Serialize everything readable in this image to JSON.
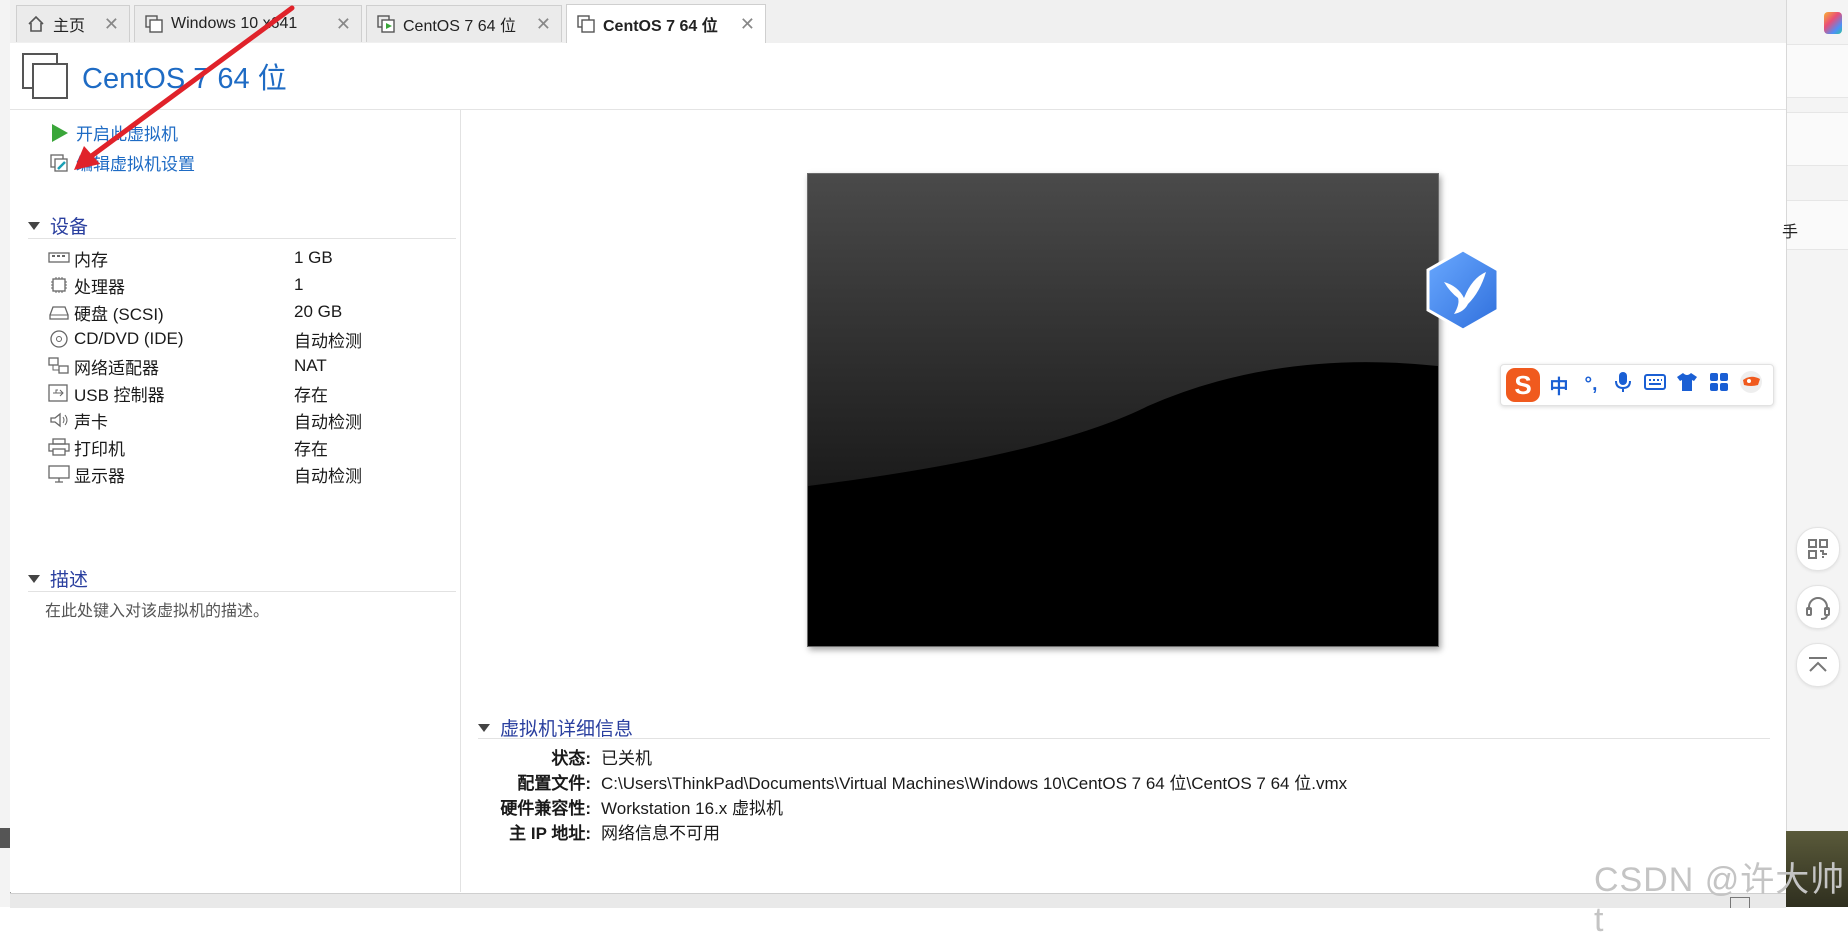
{
  "tabs": [
    {
      "label": "主页",
      "icon": "home-icon"
    },
    {
      "label": "Windows 10 x641",
      "icon": "vm-icon"
    },
    {
      "label": "CentOS 7 64 位",
      "icon": "vm-play-icon"
    },
    {
      "label": "CentOS 7 64 位",
      "icon": "vm-icon",
      "active": true
    }
  ],
  "header": {
    "title": "CentOS 7 64 位"
  },
  "commands": {
    "power_on": "开启此虚拟机",
    "edit_settings": "编辑虚拟机设置"
  },
  "devices": {
    "heading": "设备",
    "items": [
      {
        "name": "内存",
        "value": "1 GB",
        "icon": "memory-icon"
      },
      {
        "name": "处理器",
        "value": "1",
        "icon": "cpu-icon"
      },
      {
        "name": "硬盘 (SCSI)",
        "value": "20 GB",
        "icon": "hard-disk-icon"
      },
      {
        "name": "CD/DVD (IDE)",
        "value": "自动检测",
        "icon": "cd-dvd-icon"
      },
      {
        "name": "网络适配器",
        "value": "NAT",
        "icon": "network-adapter-icon"
      },
      {
        "name": "USB 控制器",
        "value": "存在",
        "icon": "usb-icon"
      },
      {
        "name": "声卡",
        "value": "自动检测",
        "icon": "speaker-icon"
      },
      {
        "name": "打印机",
        "value": "存在",
        "icon": "printer-icon"
      },
      {
        "name": "显示器",
        "value": "自动检测",
        "icon": "monitor-icon"
      }
    ]
  },
  "description": {
    "heading": "描述",
    "placeholder": "在此处键入对该虚拟机的描述。"
  },
  "details": {
    "heading": "虚拟机详细信息",
    "rows": [
      {
        "key": "状态:",
        "value": "已关机"
      },
      {
        "key": "配置文件:",
        "value": "C:\\Users\\ThinkPad\\Documents\\Virtual Machines\\Windows 10\\CentOS 7 64 位\\CentOS 7 64 位.vmx"
      },
      {
        "key": "硬件兼容性:",
        "value": "Workstation 16.x 虚拟机"
      },
      {
        "key": "主 IP 地址:",
        "value": "网络信息不可用"
      }
    ]
  },
  "ime_toolbar": {
    "mode_label": "中",
    "punct_label": "°,"
  },
  "right_edge": {
    "text": "手"
  },
  "watermark": "CSDN @许大帅t",
  "colors": {
    "accent_link": "#1e6bc4",
    "section_heading": "#2a3f9f",
    "play_green": "#3aa63a",
    "annotation_red": "#e0222a"
  }
}
